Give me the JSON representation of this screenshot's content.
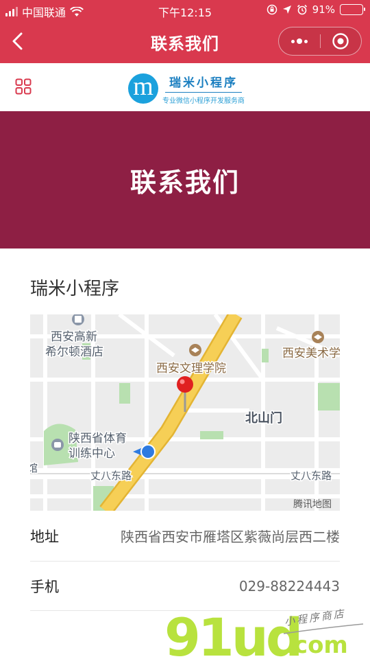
{
  "status_bar": {
    "carrier": "中国联通",
    "time": "下午12:15",
    "battery_text": "91%",
    "battery_level": 0.91
  },
  "nav": {
    "title": "联系我们",
    "back_icon": "chevron-left-icon",
    "more_icon": "more-dots-icon",
    "close_icon": "target-circle-icon"
  },
  "brand": {
    "logo_letter": "m",
    "name": "瑞米小程序",
    "tagline": "专业微信小程序开发服务商",
    "color": "#1b7fc0"
  },
  "banner": {
    "title": "联系我们",
    "color": "#8e1f44"
  },
  "company": {
    "name": "瑞米小程序"
  },
  "map": {
    "labels": {
      "hotel": "西安高新希尔顿酒店",
      "hotel_line1": "西安高新",
      "hotel_line2": "希尔顿酒店",
      "college": "西安文理学院",
      "art": "西安美术学",
      "area": "北山门",
      "sports_line1": "陕西省体育",
      "sports_line2": "训练中心",
      "road_left": "丈八东路",
      "road_right": "丈八东路",
      "edge": "馆",
      "provider": "腾讯地图"
    }
  },
  "info": {
    "address_label": "地址",
    "address_value": "陕西省西安市雁塔区紫薇尚层西二楼",
    "phone_label": "手机",
    "phone_value": "029-88224443"
  },
  "watermark": {
    "text": "91ud",
    "domain": ".com",
    "caption": "小程序商店"
  },
  "colors": {
    "accent": "#d9394e",
    "banner": "#8e1f44",
    "map_road": "#f0c24a"
  }
}
